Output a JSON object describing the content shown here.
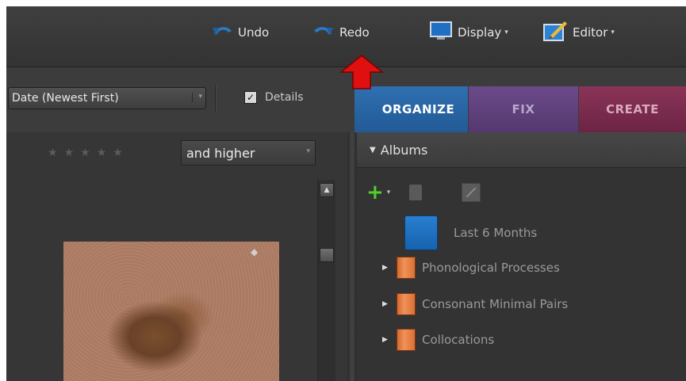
{
  "toolbar": {
    "undo_label": "Undo",
    "redo_label": "Redo",
    "display_label": "Display",
    "editor_label": "Editor",
    "caret": "▾"
  },
  "browser": {
    "sort_value": "Date (Newest First)",
    "details_label": "Details",
    "details_checked": true,
    "rating_filter": "and higher"
  },
  "tabs": [
    {
      "label": "ORGANIZE",
      "active": true
    },
    {
      "label": "FIX",
      "active": false
    },
    {
      "label": "CREATE",
      "active": false
    }
  ],
  "albums_panel": {
    "header": "Albums",
    "items": [
      {
        "label": "Last 6 Months",
        "type": "smart"
      },
      {
        "label": "Phonological Processes",
        "type": "category"
      },
      {
        "label": "Consonant Minimal Pairs",
        "type": "category"
      },
      {
        "label": "Collocations",
        "type": "category"
      }
    ]
  },
  "colors": {
    "organize": "#2f6fb1",
    "fix": "#6b4a8a",
    "create": "#8a3458",
    "arrow": "#e01010",
    "add": "#4fd02d"
  },
  "icons": {
    "undo": "undo-icon",
    "redo": "redo-icon",
    "display": "display-icon",
    "editor": "editor-icon"
  }
}
